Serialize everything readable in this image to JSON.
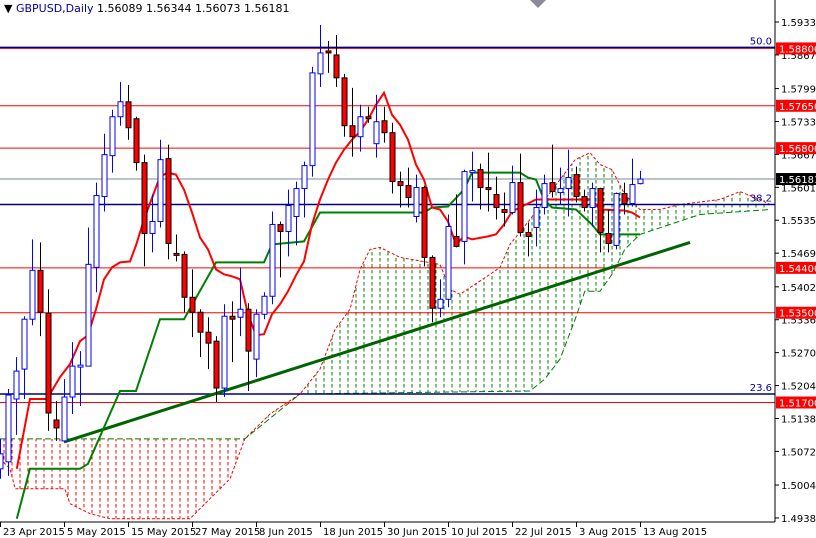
{
  "header": {
    "symbol": "GBPUSD,Daily",
    "ohlc": "1.56089 1.56344 1.56073 1.56181"
  },
  "colors": {
    "bull": "#0000ff",
    "bear": "#ff0000",
    "tenkan": "#ff0000",
    "kijun": "#008000",
    "trendline": "#006400",
    "level_line": "#ff0000",
    "fib_line": "#000080",
    "price_line": "#778899"
  },
  "chart_data": {
    "type": "candlestick",
    "title": "GBPUSD,Daily",
    "ylim": [
      1.49385,
      1.5933
    ],
    "y_ticks": [
      "1.59330",
      "1.58670",
      "1.57995",
      "1.57335",
      "1.56675",
      "1.56015",
      "1.55355",
      "1.54695",
      "1.54020",
      "1.53360",
      "1.52700",
      "1.52040",
      "1.51380",
      "1.50720",
      "1.50045",
      "1.49385"
    ],
    "x_labels": [
      {
        "index": 0,
        "label": "23 Apr 2015"
      },
      {
        "index": 8,
        "label": "5 May 2015"
      },
      {
        "index": 16,
        "label": "15 May 2015"
      },
      {
        "index": 24,
        "label": "27 May 2015"
      },
      {
        "index": 32,
        "label": "8 Jun 2015"
      },
      {
        "index": 40,
        "label": "18 Jun 2015"
      },
      {
        "index": 48,
        "label": "30 Jun 2015"
      },
      {
        "index": 56,
        "label": "10 Jul 2015"
      },
      {
        "index": 64,
        "label": "22 Jul 2015"
      },
      {
        "index": 72,
        "label": "3 Aug 2015"
      },
      {
        "index": 80,
        "label": "13 Aug 2015"
      }
    ],
    "candles_ohlc": [
      [
        1.5037,
        1.5097,
        1.5017,
        1.5067
      ],
      [
        1.5051,
        1.5197,
        1.5023,
        1.5185
      ],
      [
        1.5177,
        1.5261,
        1.5105,
        1.5233
      ],
      [
        1.5237,
        1.5343,
        1.5177,
        1.5337
      ],
      [
        1.5337,
        1.5497,
        1.5325,
        1.5435
      ],
      [
        1.5435,
        1.5491,
        1.5303,
        1.5351
      ],
      [
        1.5349,
        1.5397,
        1.5113,
        1.5149
      ],
      [
        1.5135,
        1.5173,
        1.5093,
        1.5119
      ],
      [
        1.5093,
        1.5217,
        1.5091,
        1.5181
      ],
      [
        1.5181,
        1.5291,
        1.5147,
        1.5243
      ],
      [
        1.5241,
        1.5273,
        1.5163,
        1.5245
      ],
      [
        1.5243,
        1.5521,
        1.5243,
        1.5447
      ],
      [
        1.5441,
        1.5611,
        1.5391,
        1.5585
      ],
      [
        1.5583,
        1.5709,
        1.5553,
        1.5667
      ],
      [
        1.5665,
        1.5757,
        1.5631,
        1.5743
      ],
      [
        1.5743,
        1.5813,
        1.5725,
        1.5773
      ],
      [
        1.5773,
        1.5807,
        1.5697,
        1.5721
      ],
      [
        1.5739,
        1.5743,
        1.5635,
        1.5651
      ],
      [
        1.5651,
        1.5667,
        1.5443,
        1.5509
      ],
      [
        1.5509,
        1.5587,
        1.5471,
        1.5533
      ],
      [
        1.5533,
        1.5697,
        1.5521,
        1.5657
      ],
      [
        1.5659,
        1.5687,
        1.5457,
        1.5489
      ],
      [
        1.5469,
        1.5507,
        1.5453,
        1.5465
      ],
      [
        1.5467,
        1.5473,
        1.5351,
        1.5381
      ],
      [
        1.5381,
        1.5437,
        1.5301,
        1.5351
      ],
      [
        1.5351,
        1.5357,
        1.5261,
        1.5311
      ],
      [
        1.5311,
        1.5341,
        1.5237,
        1.5289
      ],
      [
        1.5293,
        1.5303,
        1.5171,
        1.5199
      ],
      [
        1.5199,
        1.5367,
        1.5181,
        1.5343
      ],
      [
        1.5343,
        1.5373,
        1.5251,
        1.5337
      ],
      [
        1.5341,
        1.5441,
        1.5303,
        1.5357
      ],
      [
        1.5357,
        1.5369,
        1.5193,
        1.5273
      ],
      [
        1.5257,
        1.5357,
        1.5221,
        1.5347
      ],
      [
        1.5347,
        1.5391,
        1.5337,
        1.5383
      ],
      [
        1.5383,
        1.5553,
        1.5367,
        1.5527
      ],
      [
        1.5527,
        1.5533,
        1.5421,
        1.5513
      ],
      [
        1.5513,
        1.5597,
        1.5463,
        1.5565
      ],
      [
        1.5543,
        1.5613,
        1.5485,
        1.5599
      ],
      [
        1.5599,
        1.5653,
        1.5541,
        1.5645
      ],
      [
        1.5645,
        1.5843,
        1.5623,
        1.5831
      ],
      [
        1.5829,
        1.5927,
        1.5803,
        1.5871
      ],
      [
        1.5875,
        1.5895,
        1.5831,
        1.5871
      ],
      [
        1.5867,
        1.5907,
        1.5803,
        1.5821
      ],
      [
        1.5821,
        1.5829,
        1.5703,
        1.5725
      ],
      [
        1.5725,
        1.5801,
        1.5663,
        1.5703
      ],
      [
        1.5703,
        1.5767,
        1.5673,
        1.5743
      ],
      [
        1.5743,
        1.5763,
        1.5731,
        1.5739
      ],
      [
        1.5689,
        1.5787,
        1.5661,
        1.5733
      ],
      [
        1.5735,
        1.5763,
        1.5691,
        1.5711
      ],
      [
        1.5711,
        1.5731,
        1.5589,
        1.5613
      ],
      [
        1.5613,
        1.5633,
        1.5561,
        1.5605
      ],
      [
        1.5605,
        1.5641,
        1.5561,
        1.5581
      ],
      [
        1.5543,
        1.5627,
        1.5531,
        1.5601
      ],
      [
        1.5601,
        1.5605,
        1.5443,
        1.5461
      ],
      [
        1.5461,
        1.5465,
        1.5331,
        1.5359
      ],
      [
        1.5359,
        1.5417,
        1.5341,
        1.5377
      ],
      [
        1.5377,
        1.5547,
        1.5361,
        1.5523
      ],
      [
        1.5503,
        1.5587,
        1.5481,
        1.5483
      ],
      [
        1.5493,
        1.5637,
        1.5447,
        1.5633
      ],
      [
        1.5631,
        1.5673,
        1.5573,
        1.5635
      ],
      [
        1.5637,
        1.5649,
        1.5557,
        1.5601
      ],
      [
        1.5601,
        1.5671,
        1.5553,
        1.5597
      ],
      [
        1.5587,
        1.5623,
        1.5537,
        1.5561
      ],
      [
        1.5557,
        1.5591,
        1.5523,
        1.5551
      ],
      [
        1.5551,
        1.5645,
        1.5547,
        1.5611
      ],
      [
        1.5611,
        1.5669,
        1.5503,
        1.5511
      ],
      [
        1.5511,
        1.5531,
        1.5463,
        1.5503
      ],
      [
        1.5521,
        1.5597,
        1.5483,
        1.5561
      ],
      [
        1.5561,
        1.5627,
        1.5547,
        1.5609
      ],
      [
        1.5611,
        1.5687,
        1.5581,
        1.5593
      ],
      [
        1.5591,
        1.5641,
        1.5567,
        1.5599
      ],
      [
        1.5599,
        1.5677,
        1.5543,
        1.5621
      ],
      [
        1.5627,
        1.5643,
        1.5571,
        1.5583
      ],
      [
        1.5583,
        1.5597,
        1.5553,
        1.5561
      ],
      [
        1.5561,
        1.5611,
        1.5523,
        1.5599
      ],
      [
        1.5599,
        1.5601,
        1.5471,
        1.5511
      ],
      [
        1.5509,
        1.5557,
        1.5471,
        1.5489
      ],
      [
        1.5485,
        1.5591,
        1.5477,
        1.5589
      ],
      [
        1.5589,
        1.5611,
        1.5547,
        1.5569
      ],
      [
        1.5569,
        1.5659,
        1.5563,
        1.5607
      ],
      [
        1.56089,
        1.56344,
        1.56073,
        1.56181
      ]
    ],
    "tenkan_sen": [
      [
        2.1,
        1.5037
      ],
      [
        3.75,
        1.5177
      ],
      [
        5.9,
        1.5177
      ],
      [
        6.25,
        1.5187
      ],
      [
        7.5,
        1.5221
      ],
      [
        8.75,
        1.5247
      ],
      [
        10,
        1.5293
      ],
      [
        11,
        1.5305
      ],
      [
        12,
        1.5357
      ],
      [
        13,
        1.5417
      ],
      [
        14,
        1.5441
      ],
      [
        15,
        1.5451
      ],
      [
        16.25,
        1.5453
      ],
      [
        17,
        1.5485
      ],
      [
        18,
        1.5537
      ],
      [
        20,
        1.5623
      ],
      [
        21,
        1.5631
      ],
      [
        22,
        1.5627
      ],
      [
        23,
        1.5597
      ],
      [
        24,
        1.5551
      ],
      [
        25,
        1.5501
      ],
      [
        26,
        1.5477
      ],
      [
        27,
        1.5437
      ],
      [
        28,
        1.5427
      ],
      [
        29,
        1.5423
      ],
      [
        30,
        1.5417
      ],
      [
        31,
        1.5347
      ],
      [
        32,
        1.5305
      ],
      [
        33,
        1.5307
      ],
      [
        34,
        1.5347
      ],
      [
        35,
        1.5367
      ],
      [
        36,
        1.5393
      ],
      [
        37,
        1.5425
      ],
      [
        38,
        1.5453
      ],
      [
        39,
        1.5527
      ],
      [
        40,
        1.5577
      ],
      [
        41,
        1.5617
      ],
      [
        42,
        1.5651
      ],
      [
        43,
        1.5677
      ],
      [
        44,
        1.5697
      ],
      [
        45,
        1.5713
      ],
      [
        46,
        1.5737
      ],
      [
        47,
        1.5767
      ],
      [
        48,
        1.5791
      ],
      [
        49,
        1.5747
      ],
      [
        50,
        1.5727
      ],
      [
        51,
        1.5697
      ],
      [
        52,
        1.5647
      ],
      [
        53,
        1.5617
      ],
      [
        54,
        1.5561
      ],
      [
        55,
        1.5557
      ],
      [
        56,
        1.5533
      ],
      [
        57,
        1.5487
      ],
      [
        58,
        1.5503
      ],
      [
        59,
        1.5497
      ],
      [
        61,
        1.5503
      ],
      [
        62,
        1.5507
      ],
      [
        63,
        1.5527
      ],
      [
        64,
        1.5553
      ],
      [
        65,
        1.5561
      ],
      [
        67,
        1.5577
      ],
      [
        74,
        1.5577
      ],
      [
        75,
        1.5557
      ],
      [
        78,
        1.5555
      ],
      [
        79,
        1.5551
      ],
      [
        80,
        1.5541
      ]
    ],
    "kijun_sen": [
      [
        2.1,
        1.4937
      ],
      [
        3.75,
        1.5037
      ],
      [
        10,
        1.5037
      ],
      [
        11,
        1.5047
      ],
      [
        15,
        1.5193
      ],
      [
        17,
        1.5193
      ],
      [
        20,
        1.5337
      ],
      [
        23,
        1.5337
      ],
      [
        27,
        1.5451
      ],
      [
        33,
        1.5451
      ],
      [
        34,
        1.5487
      ],
      [
        38,
        1.5493
      ],
      [
        40,
        1.5551
      ],
      [
        53,
        1.5551
      ],
      [
        54,
        1.5561
      ],
      [
        56,
        1.5563
      ],
      [
        58,
        1.5597
      ],
      [
        59,
        1.5631
      ],
      [
        65,
        1.5631
      ],
      [
        66,
        1.5621
      ],
      [
        67,
        1.5617
      ],
      [
        68,
        1.5577
      ],
      [
        69,
        1.5561
      ],
      [
        72,
        1.5557
      ],
      [
        74,
        1.5527
      ],
      [
        75,
        1.5507
      ],
      [
        80,
        1.5507
      ]
    ],
    "senkou_a": [
      [
        0,
        1.5057
      ],
      [
        1.25,
        1.5037
      ],
      [
        1.9,
        1.4997
      ],
      [
        8.1,
        1.4997
      ],
      [
        8.75,
        1.4967
      ],
      [
        11.25,
        1.4947
      ],
      [
        13.75,
        1.4937
      ],
      [
        23.75,
        1.4937
      ],
      [
        28.75,
        1.5017
      ],
      [
        30.6,
        1.5097
      ],
      [
        33.75,
        1.5147
      ],
      [
        37.5,
        1.5187
      ],
      [
        40,
        1.5237
      ],
      [
        41.9,
        1.5317
      ],
      [
        43.75,
        1.5357
      ],
      [
        45,
        1.5437
      ],
      [
        46.25,
        1.5477
      ],
      [
        47.5,
        1.5481
      ],
      [
        50,
        1.5461
      ],
      [
        55,
        1.5447
      ],
      [
        56.25,
        1.5397
      ],
      [
        57.5,
        1.5387
      ],
      [
        61.25,
        1.5427
      ],
      [
        62.5,
        1.5441
      ],
      [
        63.75,
        1.5487
      ],
      [
        66.25,
        1.5537
      ],
      [
        68.1,
        1.5577
      ],
      [
        70,
        1.5617
      ],
      [
        71.9,
        1.5657
      ],
      [
        73.75,
        1.5671
      ],
      [
        75,
        1.5647
      ],
      [
        76.5,
        1.5637
      ],
      [
        78.1,
        1.5587
      ],
      [
        80,
        1.5557
      ],
      [
        82.5,
        1.5557
      ],
      [
        85,
        1.5567
      ],
      [
        90,
        1.5577
      ],
      [
        92.5,
        1.5593
      ],
      [
        95,
        1.5577
      ],
      [
        96.25,
        1.5567
      ]
    ],
    "senkou_b": [
      [
        0,
        1.5097
      ],
      [
        30.6,
        1.5097
      ],
      [
        37.5,
        1.5187
      ],
      [
        66.25,
        1.5193
      ],
      [
        68.1,
        1.5217
      ],
      [
        70,
        1.5257
      ],
      [
        71.9,
        1.5337
      ],
      [
        73.1,
        1.5393
      ],
      [
        75,
        1.5393
      ],
      [
        76.5,
        1.5427
      ],
      [
        78.1,
        1.5477
      ],
      [
        80,
        1.5507
      ],
      [
        87.5,
        1.5547
      ],
      [
        96.25,
        1.5557
      ]
    ],
    "trendline": [
      [
        8,
        1.5091
      ],
      [
        86.25,
        1.5491
      ]
    ],
    "levels": [
      {
        "price": 1.588,
        "label": "1.58800"
      },
      {
        "price": 1.5765,
        "label": "1.57650"
      },
      {
        "price": 1.568,
        "label": "1.56800"
      },
      {
        "price": 1.544,
        "label": "1.54400"
      },
      {
        "price": 1.535,
        "label": "1.53500"
      },
      {
        "price": 1.517,
        "label": "1.51700"
      }
    ],
    "fib_levels": [
      {
        "price": 1.5882,
        "label": "50.0"
      },
      {
        "price": 1.5567,
        "label": "38.2"
      },
      {
        "price": 1.5187,
        "label": "23.6"
      }
    ],
    "current_price": {
      "price": 1.56181,
      "label": "1.56181"
    }
  }
}
